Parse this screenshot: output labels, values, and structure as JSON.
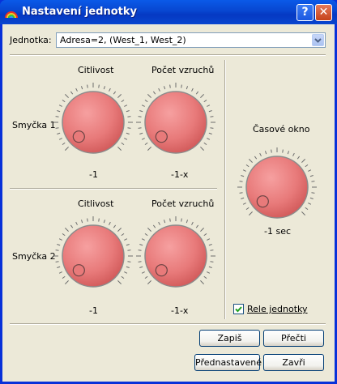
{
  "window": {
    "title": "Nastavení jednotky"
  },
  "unit": {
    "label": "Jednotka:",
    "selected": "Adresa=2, (West_1, West_2)"
  },
  "loop1": {
    "label": "Smyčka 1",
    "sensitivity": {
      "header": "Citlivost",
      "value": "-1"
    },
    "count": {
      "header": "Počet vzruchů",
      "value": "-1-x"
    }
  },
  "loop2": {
    "label": "Smyčka 2",
    "sensitivity": {
      "header": "Citlivost",
      "value": "-1"
    },
    "count": {
      "header": "Počet vzruchů",
      "value": "-1-x"
    }
  },
  "timewindow": {
    "header": "Časové okno",
    "value": "-1 sec"
  },
  "relay": {
    "label": "Rele jednotky",
    "checked": true
  },
  "buttons": {
    "write": "Zapiš",
    "read": "Přečti",
    "preset": "Přednastavené",
    "close": "Zavři"
  },
  "colors": {
    "knob": "#e87a7a",
    "titlebar": "#0a5ae8",
    "face": "#ece9d8"
  }
}
